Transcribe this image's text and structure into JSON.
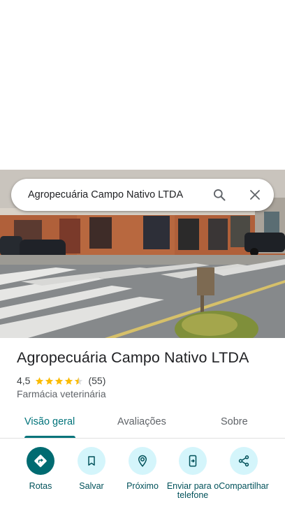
{
  "search": {
    "query": "Agropecuária Campo Nativo LTDA"
  },
  "place": {
    "title": "Agropecuária Campo Nativo LTDA",
    "rating": "4,5",
    "stars_filled": 4.5,
    "reviews_count": "(55)",
    "category": "Farmácia veterinária"
  },
  "tabs": [
    {
      "label": "Visão geral",
      "active": true
    },
    {
      "label": "Avaliações",
      "active": false
    },
    {
      "label": "Sobre",
      "active": false
    }
  ],
  "actions": [
    {
      "label": "Rotas",
      "icon": "directions-icon"
    },
    {
      "label": "Salvar",
      "icon": "bookmark-icon"
    },
    {
      "label": "Próximo",
      "icon": "nearby-icon"
    },
    {
      "label": "Enviar para o telefone",
      "icon": "send-to-phone-icon"
    },
    {
      "label": "Compartilhar",
      "icon": "share-icon"
    }
  ],
  "colors": {
    "accent": "#00737a",
    "action_bg": "#d4f5fb",
    "star": "#fbbc04"
  }
}
